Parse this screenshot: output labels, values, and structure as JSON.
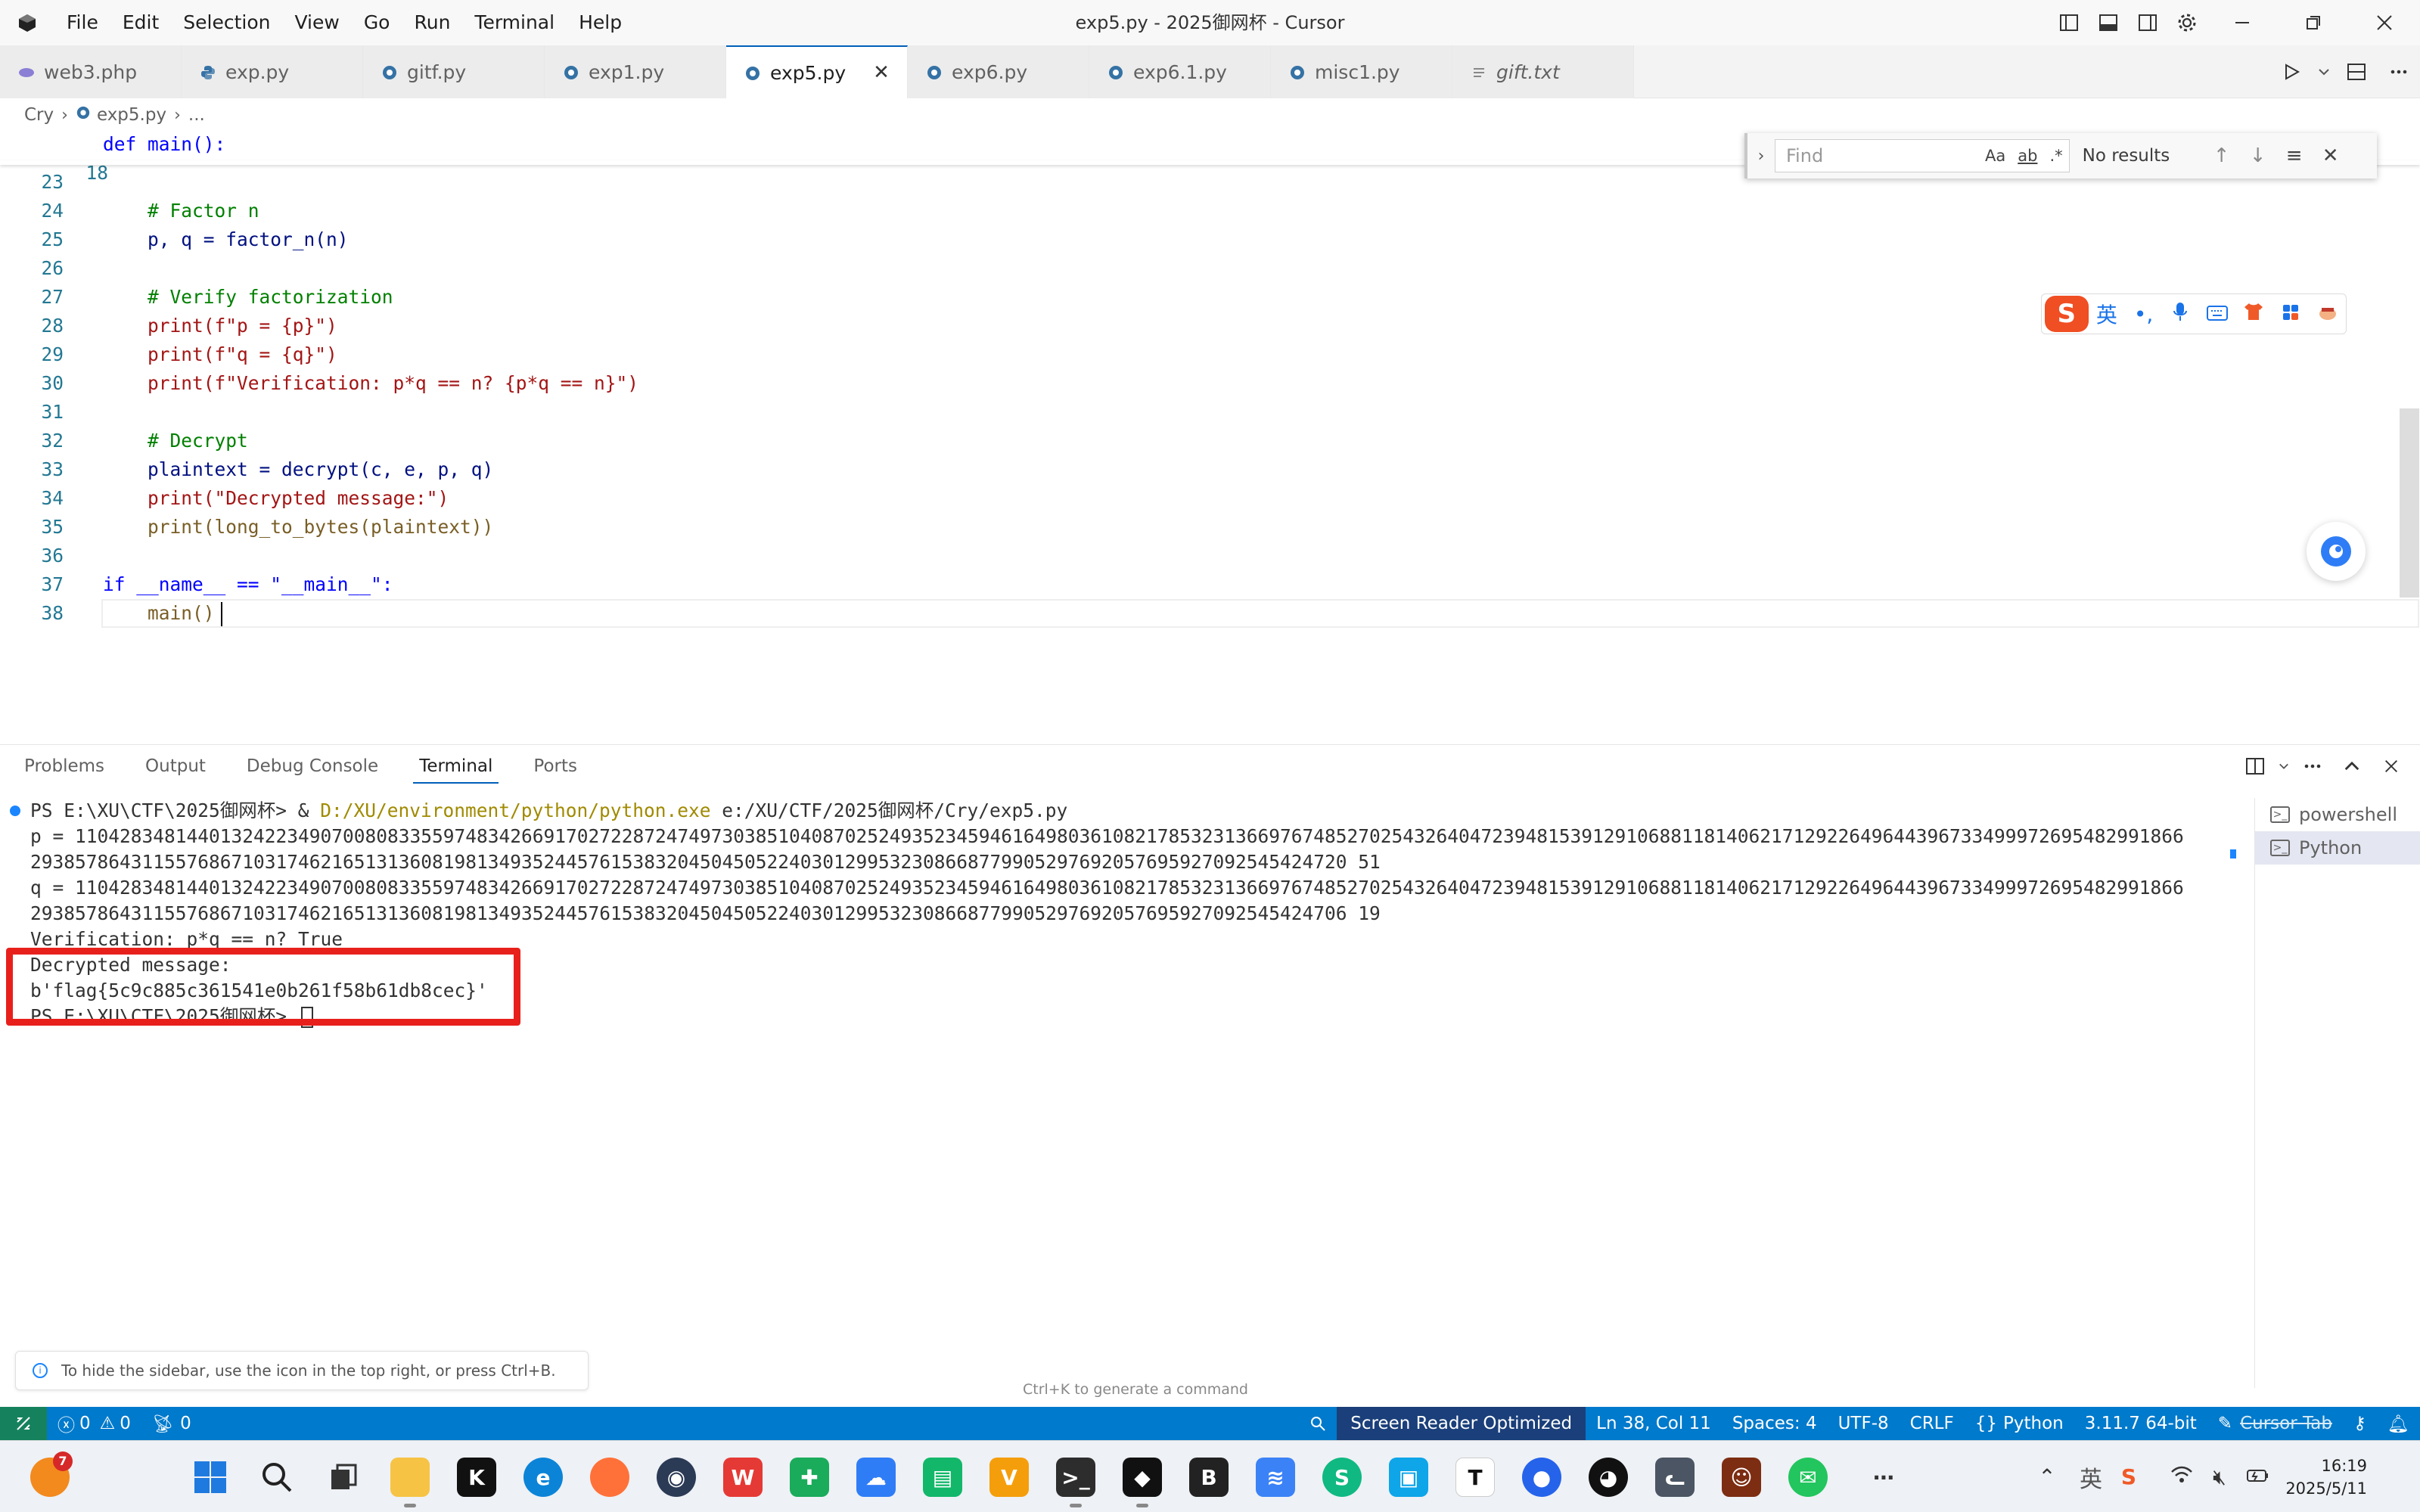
{
  "window": {
    "title": "exp5.py - 2025御网杯 - Cursor",
    "menu": [
      "File",
      "Edit",
      "Selection",
      "View",
      "Go",
      "Run",
      "Terminal",
      "Help"
    ]
  },
  "tabs": [
    {
      "label": "web3.php",
      "icon": "php-icon",
      "modified": true
    },
    {
      "label": "exp.py",
      "icon": "python-icon"
    },
    {
      "label": "gitf.py",
      "icon": "python-icon"
    },
    {
      "label": "exp1.py",
      "icon": "python-icon"
    },
    {
      "label": "exp5.py",
      "icon": "python-icon",
      "active": true
    },
    {
      "label": "exp6.py",
      "icon": "python-icon"
    },
    {
      "label": "exp6.1.py",
      "icon": "python-icon"
    },
    {
      "label": "misc1.py",
      "icon": "python-icon"
    },
    {
      "label": "gift.txt",
      "icon": "text-file-icon"
    }
  ],
  "breadcrumb": {
    "folder": "Cry",
    "file": "exp5.py",
    "more": "..."
  },
  "editor": {
    "sticky_line": {
      "num": "18",
      "text": "def main():"
    },
    "lines": [
      {
        "num": "23",
        "text": ""
      },
      {
        "num": "24",
        "text": "    # Factor n"
      },
      {
        "num": "25",
        "text": "    p, q = factor_n(n)"
      },
      {
        "num": "26",
        "text": ""
      },
      {
        "num": "27",
        "text": "    # Verify factorization"
      },
      {
        "num": "28",
        "text": "    print(f\"p = {p}\")"
      },
      {
        "num": "29",
        "text": "    print(f\"q = {q}\")"
      },
      {
        "num": "30",
        "text": "    print(f\"Verification: p*q == n? {p*q == n}\")"
      },
      {
        "num": "31",
        "text": ""
      },
      {
        "num": "32",
        "text": "    # Decrypt"
      },
      {
        "num": "33",
        "text": "    plaintext = decrypt(c, e, p, q)"
      },
      {
        "num": "34",
        "text": "    print(\"Decrypted message:\")"
      },
      {
        "num": "35",
        "text": "    print(long_to_bytes(plaintext))"
      },
      {
        "num": "36",
        "text": ""
      },
      {
        "num": "37",
        "text": "if __name__ == \"__main__\":"
      },
      {
        "num": "38",
        "text": "    main()"
      }
    ]
  },
  "find": {
    "placeholder": "Find",
    "match_case": "Aa",
    "whole_word": "ab",
    "regex": ".*",
    "result": "No results"
  },
  "ime": {
    "logo": "S",
    "items": [
      "英",
      "•,",
      "mic",
      "kbd",
      "shirt",
      "grid",
      "tools"
    ]
  },
  "panel": {
    "tabs": [
      "Problems",
      "Output",
      "Debug Console",
      "Terminal",
      "Ports"
    ],
    "active_tab": "Terminal",
    "terminal_lines": [
      {
        "prefix": "PS E:\\XU\\CTF\\2025御网杯> & ",
        "path": "D:/XU/environment/python/python.exe",
        "rest": " e:/XU/CTF/2025御网杯/Cry/exp5.py"
      },
      {
        "text": "p = 110428348144013242234907008083355974834266917027228724749730385104087025249352345946164980361082178532313669767485270254326404723948153912910688118140621712922649644396733499972695482991866"
      },
      {
        "text": "2938578643115576867103174621651313608198134935244576153832045045052240301299532308668779905297692057695927092545424720 51"
      },
      {
        "text": "q = 110428348144013242234907008083355974834266917027228724749730385104087025249352345946164980361082178532313669767485270254326404723948153912910688118140621712922649644396733499972695482991866"
      },
      {
        "text": "2938578643115576867103174621651313608198134935244576153832045045052240301299532308668779905297692057695927092545424706 19"
      },
      {
        "text": "Verification: p*q == n? True"
      },
      {
        "text": "Decrypted message:"
      },
      {
        "text": "b'flag{5c9c885c361541e0b261f58b61db8cec}'"
      },
      {
        "text": "PS E:\\XU\\CTF\\2025御网杯> "
      }
    ],
    "terminals": [
      {
        "label": "powershell"
      },
      {
        "label": "Python",
        "active": true
      }
    ],
    "hint": "To hide the sidebar, use the icon in the top right, or press Ctrl+B.",
    "ctrlk": "Ctrl+K to generate a command"
  },
  "status": {
    "errors": "0",
    "warnings": "0",
    "ports": "0",
    "screen_reader": "Screen Reader Optimized",
    "position": "Ln 38, Col 11",
    "spaces": "Spaces: 4",
    "encoding": "UTF-8",
    "eol": "CRLF",
    "language": "Python",
    "interpreter": "3.11.7 64-bit",
    "cursor_tab": "Cursor Tab",
    "colors": {
      "bar": "#007acc",
      "remote": "#16825d"
    }
  },
  "taskbar": {
    "badge": "7",
    "time": "16:19",
    "date": "2025/5/11",
    "ime_label": "英"
  }
}
